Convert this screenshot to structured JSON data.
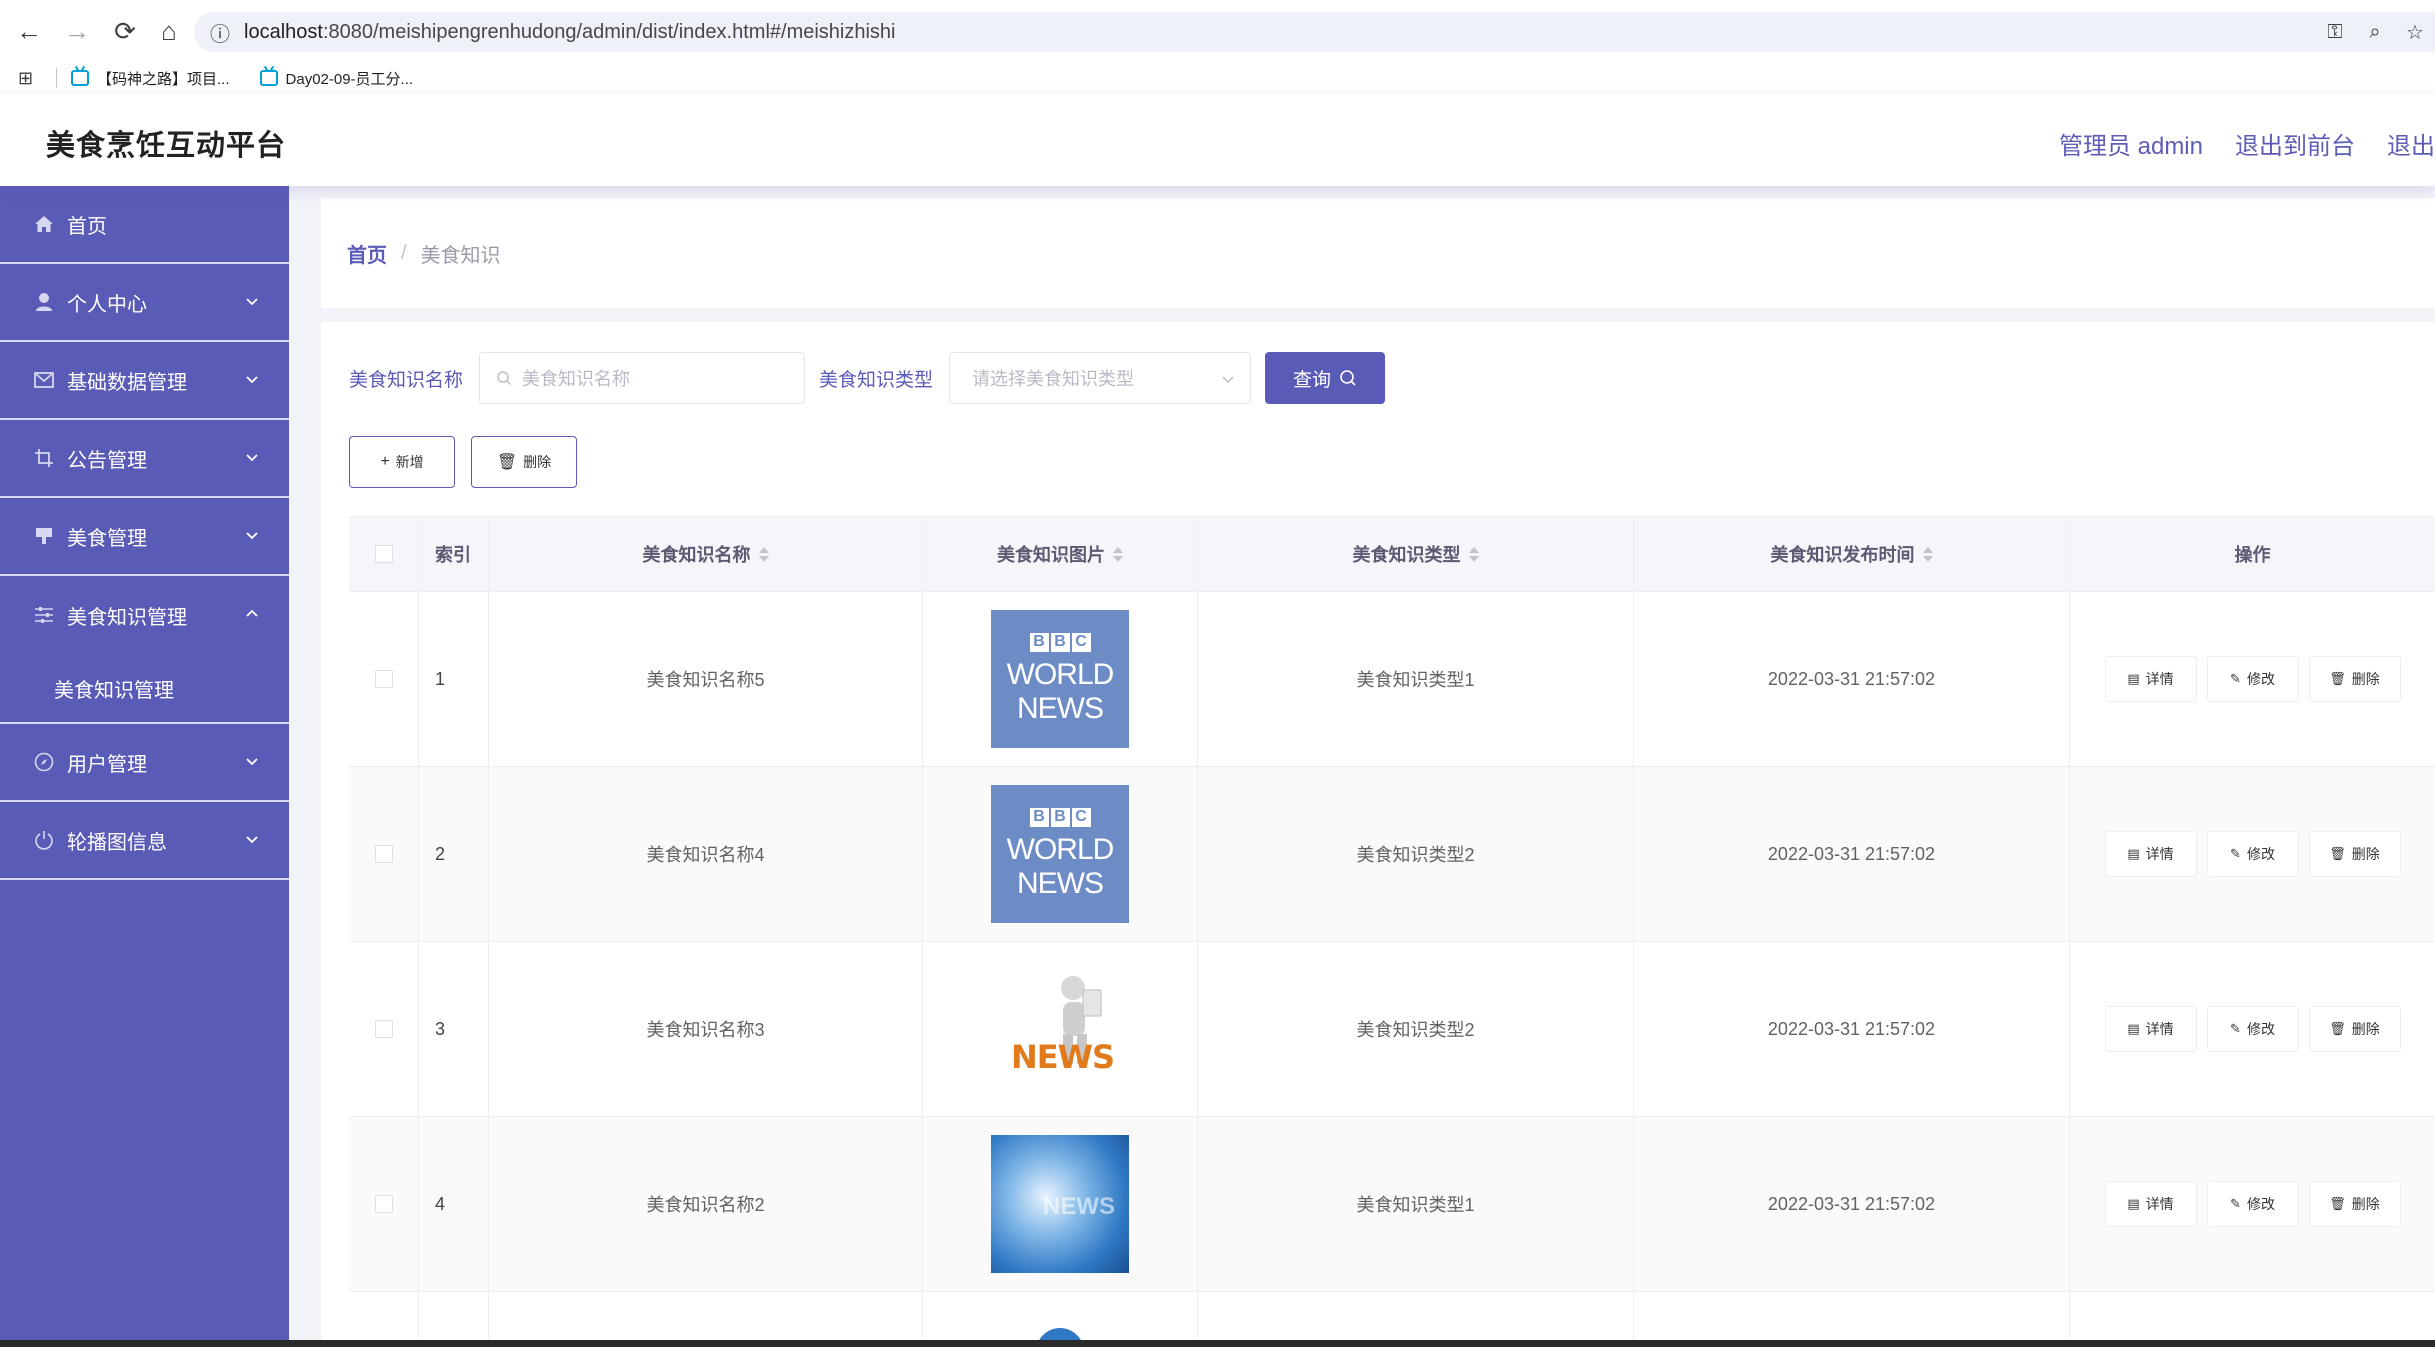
{
  "browser": {
    "url_host": "localhost",
    "url_path": ":8080/meishipengrenhudong/admin/dist/index.html#/meishizhishi",
    "bookmarks": [
      "【码神之路】项目...",
      "Day02-09-员工分..."
    ]
  },
  "header": {
    "title": "美食烹饪互动平台",
    "user": "管理员 admin",
    "exit_front": "退出到前台",
    "logout": "退出"
  },
  "sidebar": {
    "items": [
      {
        "label": "首页",
        "icon": "home-icon"
      },
      {
        "label": "个人中心",
        "icon": "user-icon"
      },
      {
        "label": "基础数据管理",
        "icon": "mail-icon"
      },
      {
        "label": "公告管理",
        "icon": "crop-icon"
      },
      {
        "label": "美食管理",
        "icon": "stamp-icon"
      },
      {
        "label": "美食知识管理",
        "icon": "sliders-icon"
      },
      {
        "label": "用户管理",
        "icon": "compass-icon"
      },
      {
        "label": "轮播图信息",
        "icon": "power-icon"
      }
    ],
    "submenu": {
      "label": "美食知识管理"
    }
  },
  "breadcrumb": {
    "home": "首页",
    "separator": "/",
    "current": "美食知识"
  },
  "search": {
    "name_label": "美食知识名称",
    "name_placeholder": "美食知识名称",
    "type_label": "美食知识类型",
    "type_placeholder": "请选择美食知识类型",
    "query_label": "查询"
  },
  "actions": {
    "add": "新增",
    "delete": "删除"
  },
  "table": {
    "headers": {
      "index": "索引",
      "name": "美食知识名称",
      "image": "美食知识图片",
      "type": "美食知识类型",
      "time": "美食知识发布时间",
      "ops": "操作"
    },
    "op_labels": {
      "detail": "详情",
      "edit": "修改",
      "delete": "删除"
    },
    "rows": [
      {
        "index": "1",
        "name": "美食知识名称5",
        "image": "bbc-world-news",
        "type": "美食知识类型1",
        "time": "2022-03-31 21:57:02"
      },
      {
        "index": "2",
        "name": "美食知识名称4",
        "image": "bbc-world-news",
        "type": "美食知识类型2",
        "time": "2022-03-31 21:57:02"
      },
      {
        "index": "3",
        "name": "美食知识名称3",
        "image": "3d-news-figure",
        "type": "美食知识类型2",
        "time": "2022-03-31 21:57:02"
      },
      {
        "index": "4",
        "name": "美食知识名称2",
        "image": "blue-news-globe",
        "type": "美食知识类型1",
        "time": "2022-03-31 21:57:02"
      }
    ],
    "image_text": {
      "bbc": "BBC",
      "world": "WORLD",
      "news": "NEWS",
      "news_3d": "NEWS",
      "news_blue": "NEWS"
    }
  },
  "colors": {
    "accent": "#5a5ab7",
    "background": "#f2f3f8"
  }
}
